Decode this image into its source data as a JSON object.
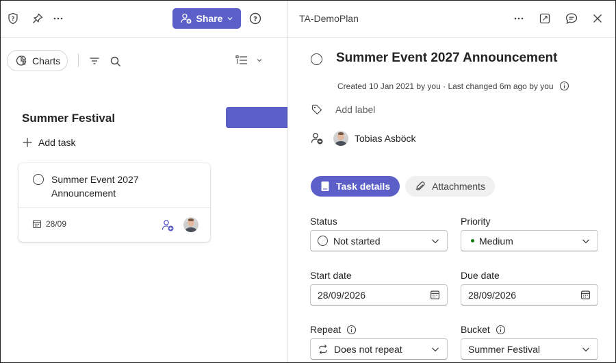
{
  "colors": {
    "accent": "#5b5fc7",
    "priority_medium": "#107c10",
    "text": "#242424",
    "muted": "#616161"
  },
  "toolbar": {
    "share_label": "Share",
    "icons": [
      "shield-question-icon",
      "pin-icon",
      "more-icon",
      "person-add-icon",
      "chevron-down-icon",
      "help-icon"
    ]
  },
  "board": {
    "charts_label": "Charts",
    "bucket_title": "Summer Festival",
    "add_task_label": "Add task",
    "card": {
      "title": "Summer Event 2027 Announcement",
      "date": "28/09"
    }
  },
  "details": {
    "plan_name": "TA-DemoPlan",
    "task_title": "Summer Event 2027 Announcement",
    "created_text": "Created 10 Jan 2021 by you · Last changed 6m ago by you",
    "add_label_placeholder": "Add label",
    "assignee": "Tobias Asböck",
    "tabs": [
      {
        "label": "Task details",
        "active": true
      },
      {
        "label": "Attachments",
        "active": false
      }
    ],
    "fields": {
      "status": {
        "label": "Status",
        "value": "Not started"
      },
      "priority": {
        "label": "Priority",
        "value": "Medium"
      },
      "start_date": {
        "label": "Start date",
        "value": "28/09/2026"
      },
      "due_date": {
        "label": "Due date",
        "value": "28/09/2026"
      },
      "repeat": {
        "label": "Repeat",
        "value": "Does not repeat"
      },
      "bucket": {
        "label": "Bucket",
        "value": "Summer Festival"
      }
    }
  }
}
